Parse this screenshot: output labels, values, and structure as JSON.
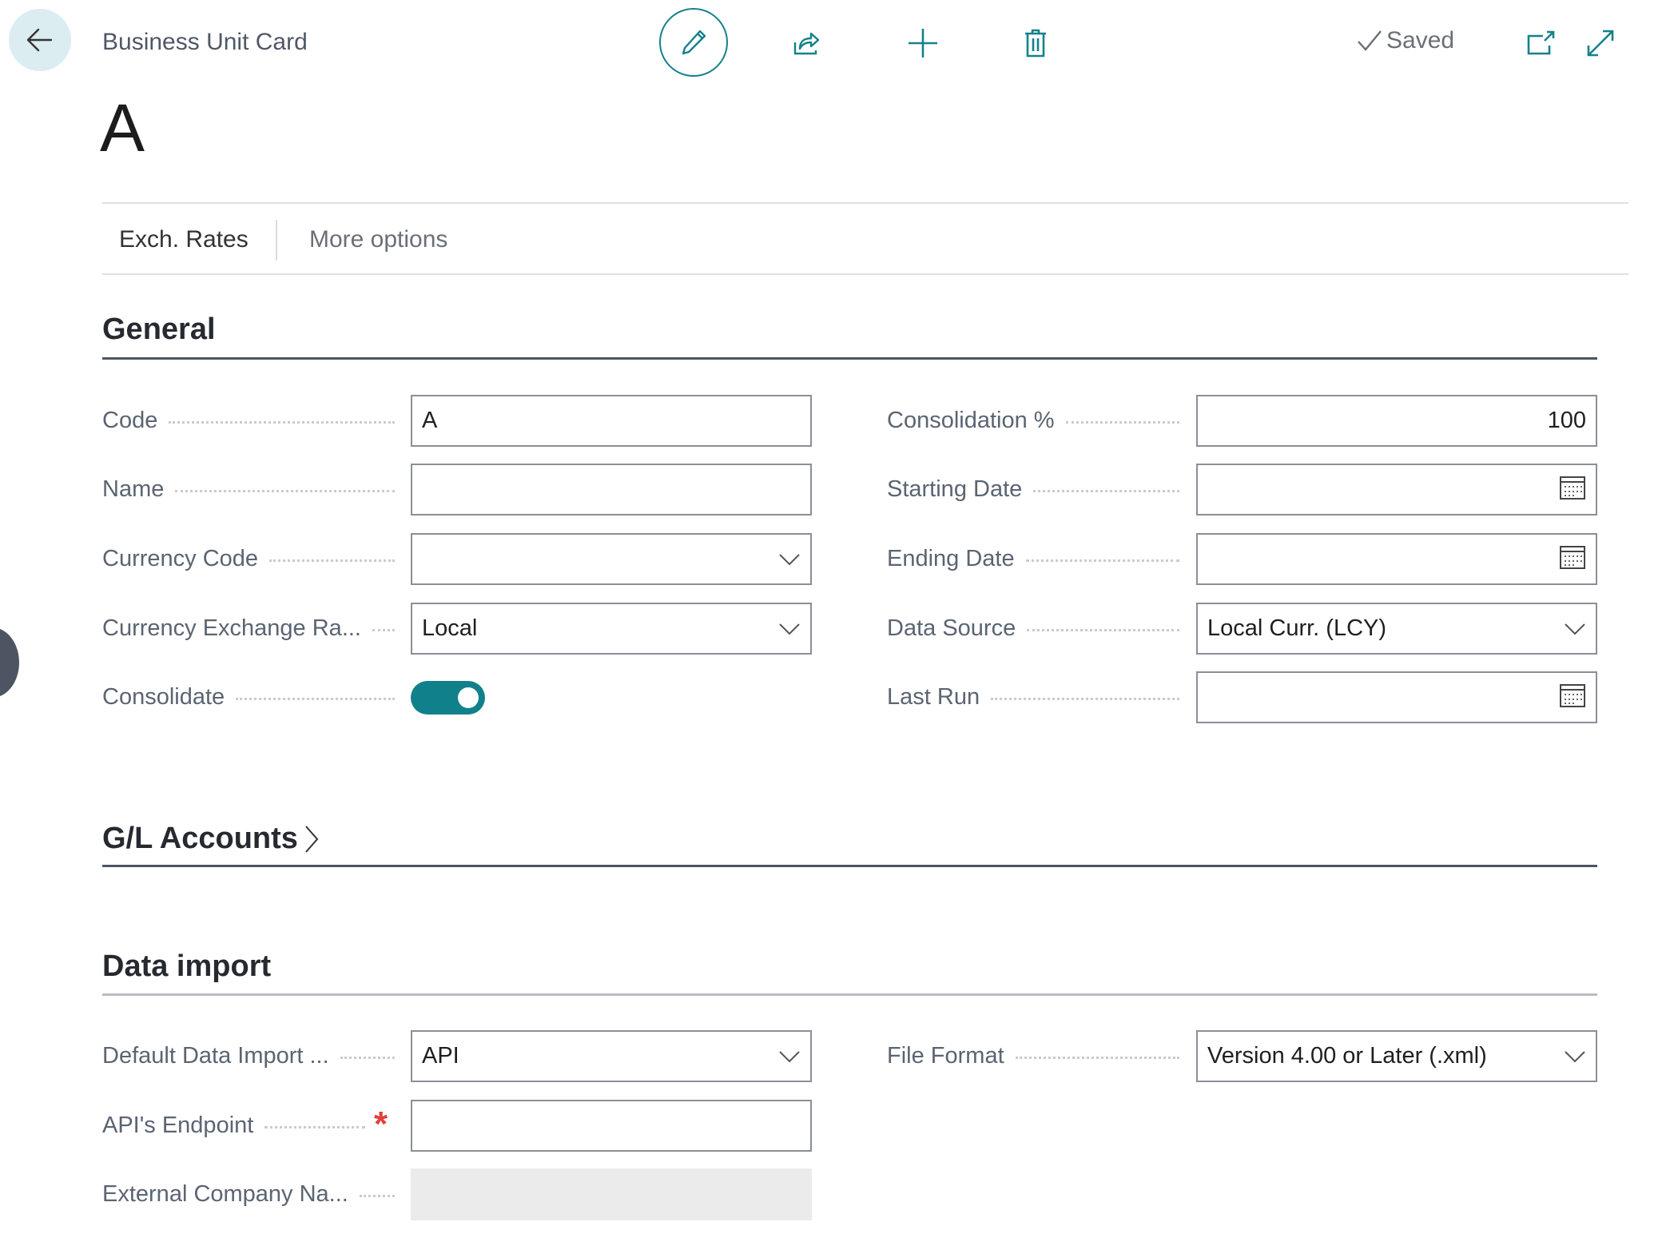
{
  "header": {
    "caption": "Business Unit Card",
    "title": "A",
    "status": "Saved",
    "icons": {
      "back": "arrow-left-icon",
      "edit": "pencil-icon",
      "share": "share-icon",
      "new": "plus-icon",
      "delete": "trash-icon",
      "saved": "checkmark-icon",
      "open_new_window": "open-in-new-window-icon",
      "expand": "expand-icon"
    }
  },
  "actions": [
    {
      "label": "Exch. Rates"
    },
    {
      "label": "More options"
    }
  ],
  "sections": {
    "general": {
      "title": "General",
      "left": [
        {
          "label": "Code",
          "value": "A",
          "type": "text"
        },
        {
          "label": "Name",
          "value": "",
          "type": "text"
        },
        {
          "label": "Currency Code",
          "value": "",
          "type": "select"
        },
        {
          "label": "Currency Exchange Ra...",
          "value": "Local",
          "type": "select"
        },
        {
          "label": "Consolidate",
          "value": true,
          "type": "toggle"
        }
      ],
      "right": [
        {
          "label": "Consolidation %",
          "value": "100",
          "type": "number"
        },
        {
          "label": "Starting Date",
          "value": "",
          "type": "date"
        },
        {
          "label": "Ending Date",
          "value": "",
          "type": "date"
        },
        {
          "label": "Data Source",
          "value": "Local Curr. (LCY)",
          "type": "select"
        },
        {
          "label": "Last Run",
          "value": "",
          "type": "date"
        }
      ]
    },
    "gl_accounts": {
      "title": "G/L Accounts",
      "collapsed": true
    },
    "data_import": {
      "title": "Data import",
      "left": [
        {
          "label": "Default Data Import ...",
          "value": "API",
          "type": "select"
        },
        {
          "label": "API's Endpoint",
          "value": "",
          "type": "text",
          "required": true
        },
        {
          "label": "External Company Na...",
          "value": "",
          "type": "text",
          "disabled": true
        }
      ],
      "right": [
        {
          "label": "File Format",
          "value": "Version 4.00 or Later (.xml)",
          "type": "select"
        }
      ]
    }
  },
  "colors": {
    "accent": "#10818b",
    "required": "#e2403a",
    "back_button_bg": "#dcedf1"
  }
}
